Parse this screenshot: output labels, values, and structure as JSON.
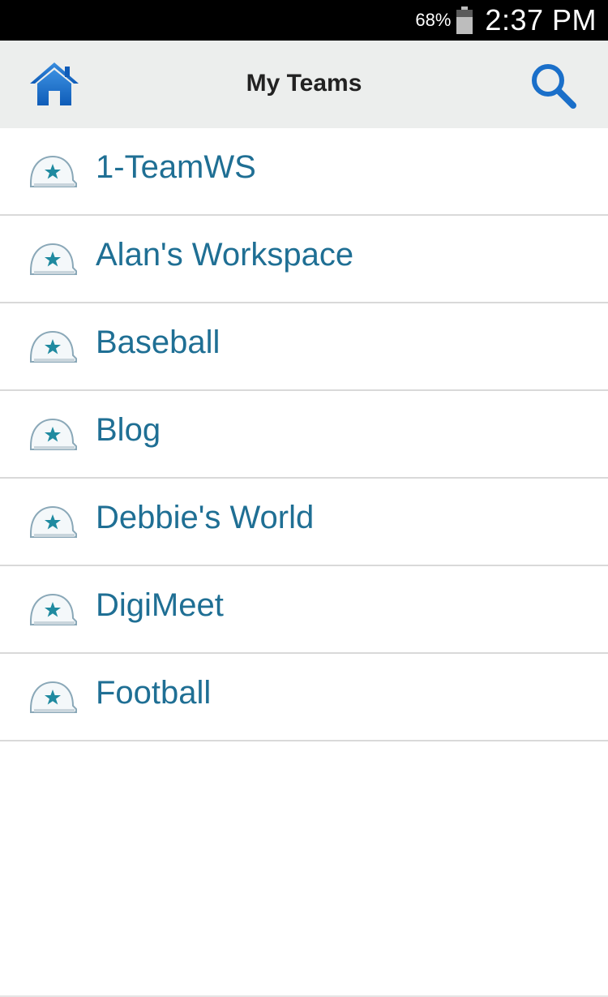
{
  "status_bar": {
    "battery_percent": "68%",
    "battery_icon": "battery-icon",
    "time": "2:37 PM"
  },
  "header": {
    "title": "My Teams",
    "home_icon": "home-icon",
    "search_icon": "search-icon"
  },
  "teams": [
    {
      "label": "1-TeamWS",
      "icon": "team-cap-icon"
    },
    {
      "label": "Alan's Workspace",
      "icon": "team-cap-icon"
    },
    {
      "label": "Baseball",
      "icon": "team-cap-icon"
    },
    {
      "label": "Blog",
      "icon": "team-cap-icon"
    },
    {
      "label": "Debbie's World",
      "icon": "team-cap-icon"
    },
    {
      "label": "DigiMeet",
      "icon": "team-cap-icon"
    },
    {
      "label": "Football",
      "icon": "team-cap-icon"
    }
  ],
  "colors": {
    "header_bg": "#eceeed",
    "accent_blue": "#1f6f94",
    "icon_blue": "#1a6fc9",
    "divider": "#d9d9d9"
  }
}
